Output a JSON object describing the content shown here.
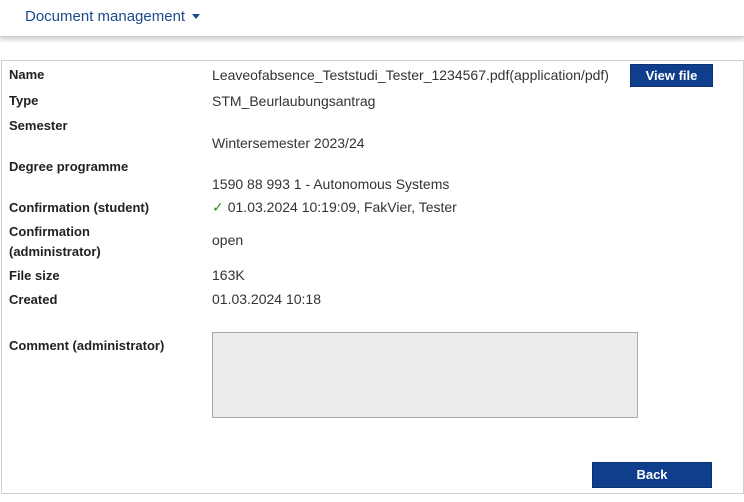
{
  "topbar": {
    "menu_label": "Document management",
    "menu_icon": "caret-down-icon"
  },
  "fields": {
    "name_label": "Name",
    "name_value": "Leaveofabsence_Teststudi_Tester_1234567.pdf(application/pdf)",
    "type_label": "Type",
    "type_value": "STM_Beurlaubungsantrag",
    "semester_label": "Semester",
    "semester_value": "Wintersemester 2023/24",
    "degree_label": "Degree programme",
    "degree_value": "1590 88 993 1 - Autonomous Systems",
    "conf_student_label": "Confirmation (student)",
    "conf_student_value": "01.03.2024 10:19:09, FakVier, Tester",
    "conf_admin_label_1": "Confirmation",
    "conf_admin_label_2": "(administrator)",
    "conf_admin_value": "open",
    "filesize_label": "File size",
    "filesize_value": "163K",
    "created_label": "Created",
    "created_value": "01.03.2024 10:18",
    "comment_label": "Comment (administrator)",
    "comment_value": ""
  },
  "buttons": {
    "view_file": "View file",
    "back": "Back"
  },
  "colors": {
    "primary": "#0f3e8c",
    "link": "#1c4a8a",
    "check": "#3a8a1a",
    "textarea_bg": "#ececec"
  }
}
